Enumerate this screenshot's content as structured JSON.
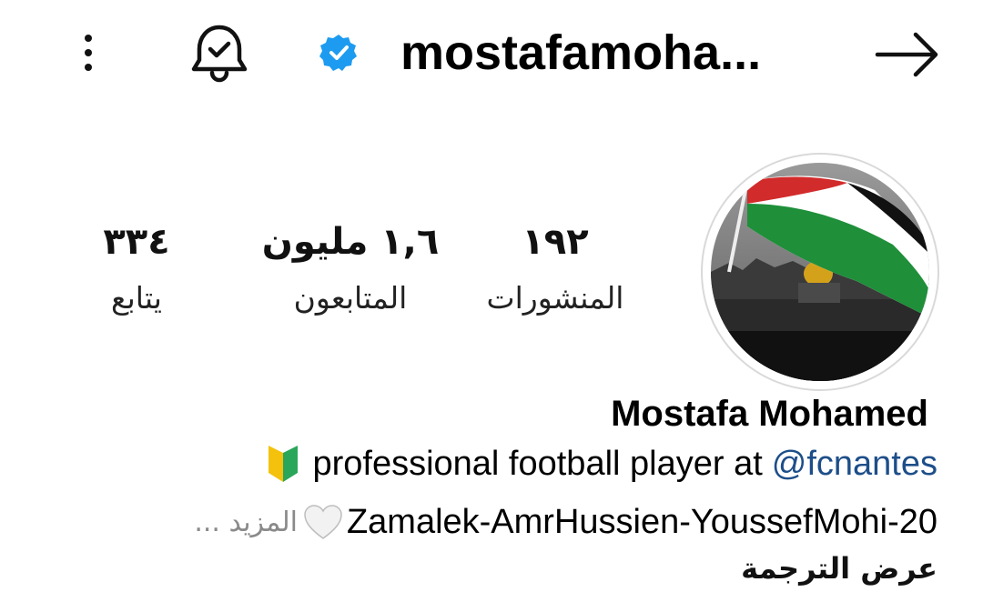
{
  "header": {
    "username": "mostafamoha...",
    "icons": {
      "more": "more-vertical-icon",
      "notifications": "bell-check-icon",
      "verified": "verified-badge-icon",
      "back": "arrow-right-icon"
    },
    "verified_color": "#1d9bf0"
  },
  "stats": {
    "posts": {
      "value": "١٩٢",
      "label": "المنشورات"
    },
    "followers": {
      "value": "١,٦ مليون",
      "label": "المتابعون"
    },
    "following": {
      "value": "٣٣٤",
      "label": "يتابع"
    }
  },
  "profile": {
    "full_name": "Mostafa Mohamed",
    "bio_line1_text": "professional football player at",
    "bio_line1_mention": "@fcnantes",
    "bio_line2_text": "Zamalek-AmrHussien-YoussefMohi-20",
    "more_label": "المزيد ...",
    "translate_label": "عرض الترجمة",
    "mention_color": "#1d4e89"
  }
}
